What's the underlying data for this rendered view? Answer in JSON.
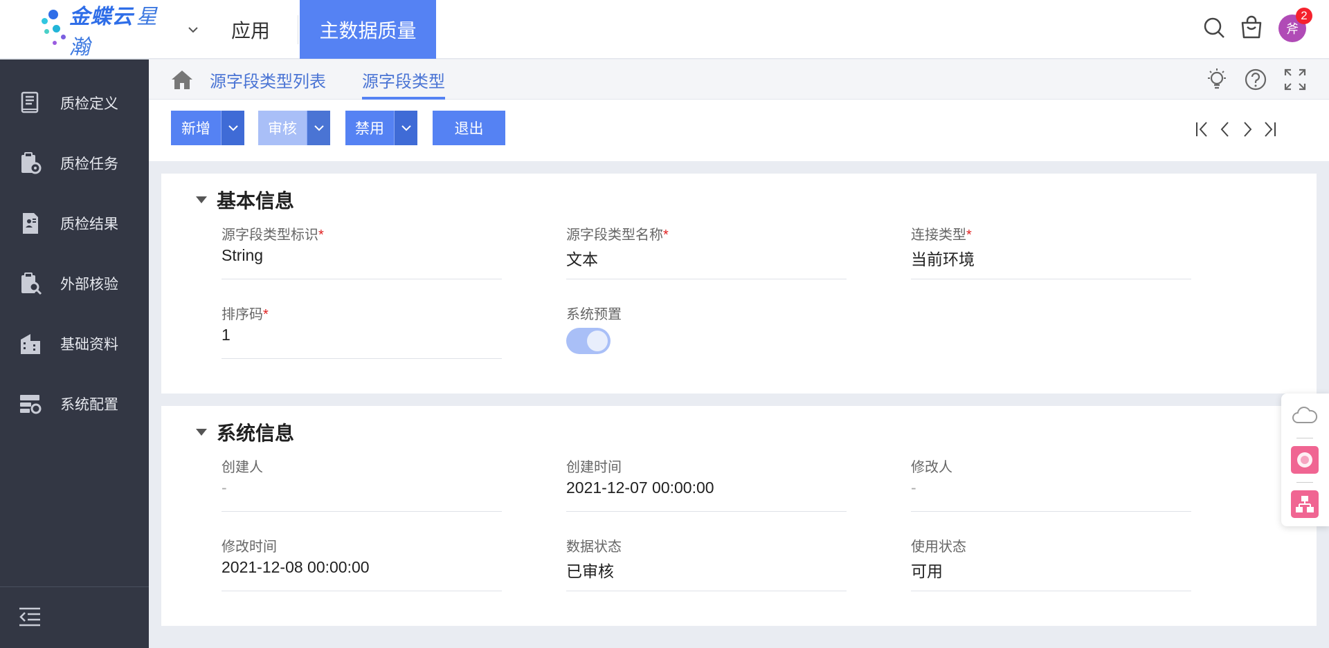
{
  "header": {
    "brand": "金蝶云",
    "brand_sub": "星瀚",
    "nav_app": "应用",
    "nav_active": "主数据质量",
    "avatar_text": "斧",
    "notification_count": "2"
  },
  "sidebar": {
    "items": [
      {
        "label": "质检定义",
        "icon": "book-icon"
      },
      {
        "label": "质检任务",
        "icon": "clipboard-gear-icon"
      },
      {
        "label": "质检结果",
        "icon": "report-icon"
      },
      {
        "label": "外部核验",
        "icon": "clipboard-search-icon"
      },
      {
        "label": "基础资料",
        "icon": "building-icon"
      },
      {
        "label": "系统配置",
        "icon": "settings-panel-icon"
      }
    ]
  },
  "breadcrumb": {
    "tabs": [
      "源字段类型列表",
      "源字段类型"
    ]
  },
  "toolbar": {
    "new_label": "新增",
    "audit_label": "审核",
    "disable_label": "禁用",
    "exit_label": "退出"
  },
  "basic_info": {
    "title": "基本信息",
    "fields": {
      "type_id": {
        "label": "源字段类型标识",
        "required_mark": "*",
        "value": "String"
      },
      "type_name": {
        "label": "源字段类型名称",
        "required_mark": "*",
        "value": "文本"
      },
      "conn_type": {
        "label": "连接类型",
        "required_mark": "*",
        "value": "当前环境"
      },
      "sort_code": {
        "label": "排序码",
        "required_mark": "*",
        "value": "1"
      },
      "system_preset": {
        "label": "系统预置",
        "value": true
      }
    }
  },
  "system_info": {
    "title": "系统信息",
    "fields": {
      "creator": {
        "label": "创建人",
        "value": "-"
      },
      "created_at": {
        "label": "创建时间",
        "value": "2021-12-07 00:00:00"
      },
      "modifier": {
        "label": "修改人",
        "value": "-"
      },
      "modified_at": {
        "label": "修改时间",
        "value": "2021-12-08 00:00:00"
      },
      "data_status": {
        "label": "数据状态",
        "value": "已审核"
      },
      "use_status": {
        "label": "使用状态",
        "value": "可用"
      }
    }
  },
  "colors": {
    "primary": "#5582f3",
    "primary_dark": "#3f6bd6",
    "sidebar_bg": "#333744",
    "required": "#e02020"
  }
}
